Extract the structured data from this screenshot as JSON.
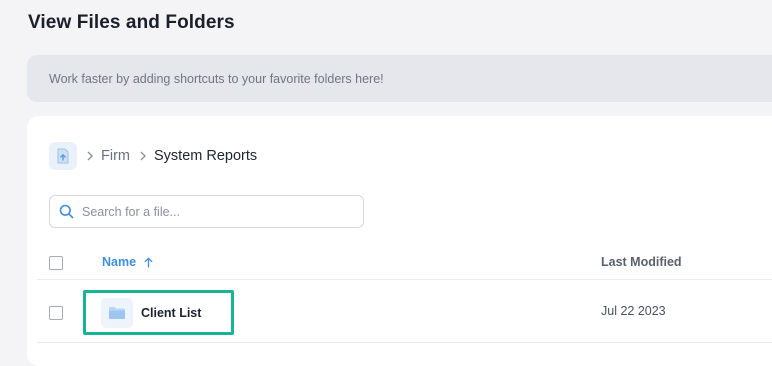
{
  "header": {
    "title": "View Files and Folders"
  },
  "shortcuts": {
    "message": "Work faster by adding shortcuts to your favorite folders here!"
  },
  "breadcrumb": {
    "home_icon": "folder-up-icon",
    "items": [
      {
        "label": "Firm",
        "current": false
      },
      {
        "label": "System Reports",
        "current": true
      }
    ]
  },
  "search": {
    "placeholder": "Search for a file...",
    "value": ""
  },
  "table": {
    "columns": {
      "name": "Name",
      "last_modified": "Last Modified"
    },
    "sort": {
      "column": "name",
      "direction": "ascending"
    },
    "rows": [
      {
        "type": "folder",
        "name": "Client List",
        "last_modified": "Jul 22 2023"
      }
    ]
  },
  "colors": {
    "accent": "#3d8fe0",
    "highlight": "#18b394",
    "background": "#f4f4f6",
    "banner": "#e6e7ec"
  }
}
